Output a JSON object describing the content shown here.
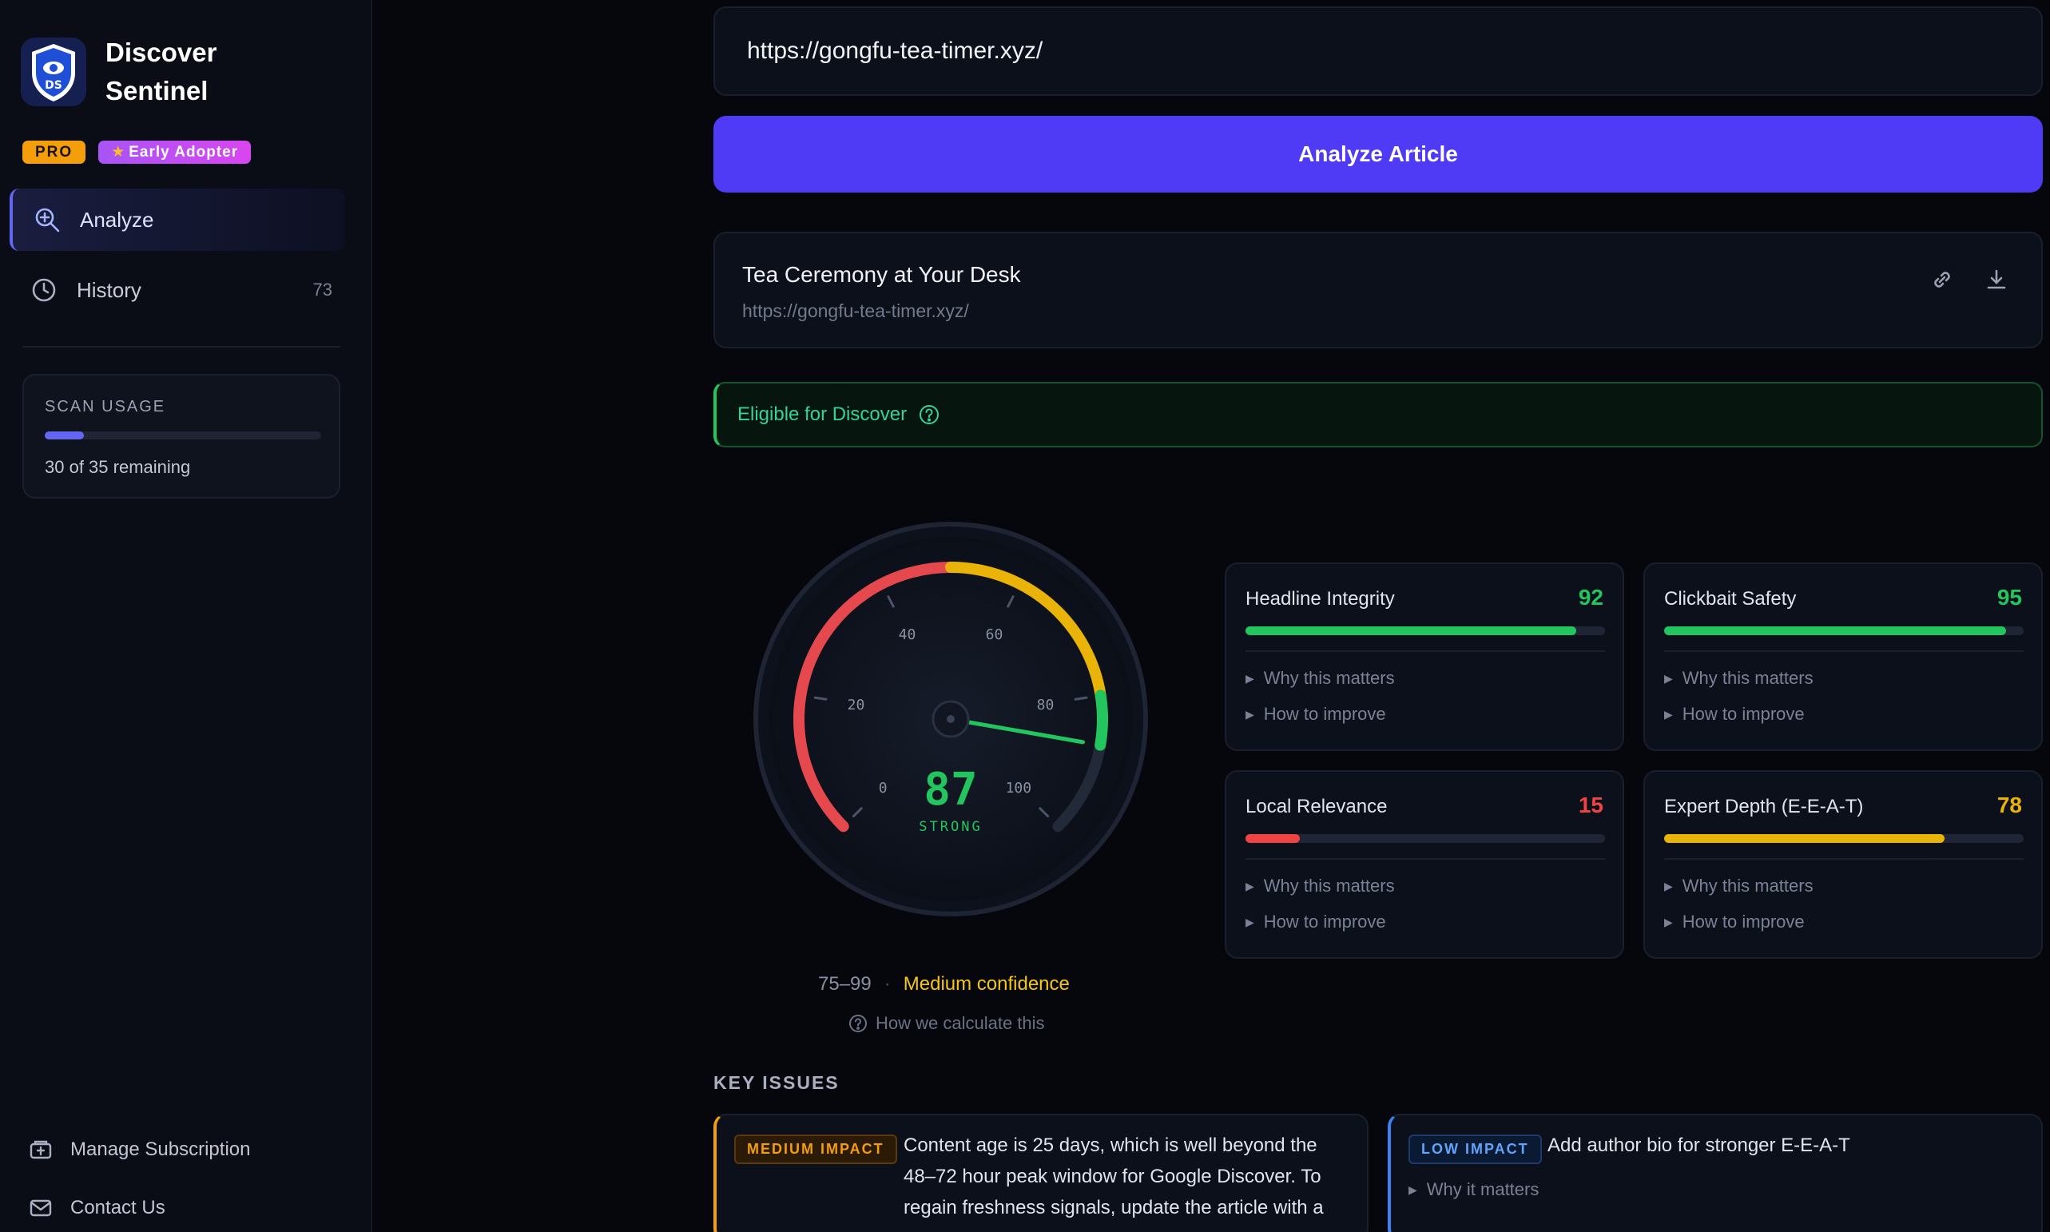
{
  "brand": {
    "name": "Discover Sentinel",
    "logo_text": "DS",
    "badge_pro": "PRO",
    "badge_early": "Early Adopter"
  },
  "nav": [
    {
      "label": "Analyze",
      "icon": "search-plus-icon",
      "active": true
    },
    {
      "label": "History",
      "icon": "clock-icon",
      "count": "73"
    }
  ],
  "usage": {
    "title": "SCAN USAGE",
    "text": "30 of 35 remaining",
    "used": 5,
    "total": 35
  },
  "footer": [
    {
      "label": "Manage Subscription",
      "icon": "billing-icon"
    },
    {
      "label": "Contact Us",
      "icon": "mail-icon"
    }
  ],
  "url_input": {
    "value": "https://gongfu-tea-timer.xyz/"
  },
  "analyze_button": "Analyze Article",
  "article": {
    "title": "Tea Ceremony at Your Desk",
    "url": "https://gongfu-tea-timer.xyz/"
  },
  "eligibility": {
    "text": "Eligible for Discover"
  },
  "gauge": {
    "score": "87",
    "grade": "STRONG",
    "score_value": 87,
    "ticks": [
      "0",
      "20",
      "40",
      "60",
      "80",
      "100"
    ],
    "range": "75–99",
    "confidence": "Medium confidence",
    "how": "How we calculate this"
  },
  "metrics": [
    {
      "label": "Headline Integrity",
      "score": "92",
      "value": 92,
      "color": "#22c55e"
    },
    {
      "label": "Clickbait Safety",
      "score": "95",
      "value": 95,
      "color": "#22c55e"
    },
    {
      "label": "Local Relevance",
      "score": "15",
      "value": 15,
      "color": "#ef4444"
    },
    {
      "label": "Expert Depth (E-E-A-T)",
      "score": "78",
      "value": 78,
      "color": "#eab308"
    }
  ],
  "metric_links": {
    "why": "Why this matters",
    "how": "How to improve"
  },
  "key_issues": {
    "title": "KEY ISSUES",
    "items": [
      {
        "impact": "MEDIUM IMPACT",
        "text_lines": [
          "Content age is 25 days, which is well beyond the",
          "48–72 hour peak window for Google Discover. To",
          "regain freshness signals, update the article with a"
        ]
      },
      {
        "impact": "LOW IMPACT",
        "text": "Add author bio for stronger E-E-A-T",
        "why": "Why it matters"
      }
    ]
  },
  "colors": {
    "accent": "#4f3bf5",
    "good": "#22c55e",
    "warn": "#eab308",
    "bad": "#ef4444"
  }
}
